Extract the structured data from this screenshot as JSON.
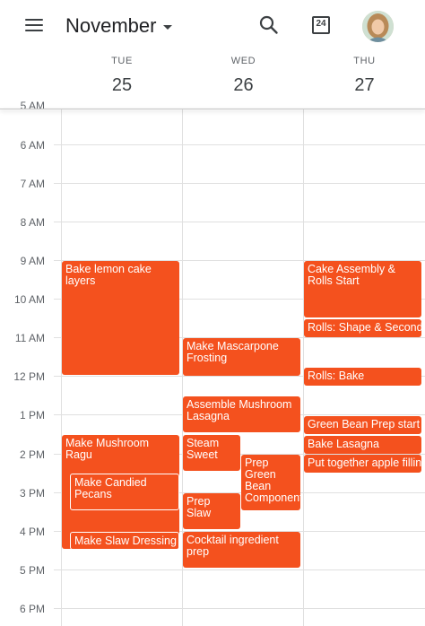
{
  "header": {
    "month": "November",
    "today_num": "24"
  },
  "days": [
    {
      "name": "TUE",
      "num": "25"
    },
    {
      "name": "WED",
      "num": "26"
    },
    {
      "name": "THU",
      "num": "27"
    }
  ],
  "time_labels": [
    "5 AM",
    "6 AM",
    "7 AM",
    "8 AM",
    "9 AM",
    "10 AM",
    "11 AM",
    "12 PM",
    "1 PM",
    "2 PM",
    "3 PM",
    "4 PM",
    "5 PM",
    "6 PM"
  ],
  "events": [
    {
      "day": "TUE",
      "title": "Bake lemon cake layers",
      "color": "#f4511e"
    },
    {
      "day": "TUE",
      "title": "Make Mushroom Ragu",
      "color": "#f4511e"
    },
    {
      "day": "TUE",
      "title": "Make Candied Pecans",
      "color": "#f4511e"
    },
    {
      "day": "TUE",
      "title": "Make Slaw Dressing",
      "color": "#f4511e"
    },
    {
      "day": "WED",
      "title": "Make Mascarpone Frosting",
      "color": "#f4511e"
    },
    {
      "day": "WED",
      "title": "Assemble Mushroom Lasagna",
      "color": "#f4511e"
    },
    {
      "day": "WED",
      "title": "Steam Sweet",
      "color": "#f4511e"
    },
    {
      "day": "WED",
      "title": "Prep Green Bean Components",
      "color": "#f4511e"
    },
    {
      "day": "WED",
      "title": "Prep Slaw",
      "color": "#f4511e"
    },
    {
      "day": "WED",
      "title": "Cocktail ingredient prep",
      "color": "#f4511e"
    },
    {
      "day": "THU",
      "title": "Cake Assembly & Rolls Start",
      "color": "#f4511e"
    },
    {
      "day": "THU",
      "title": "Rolls: Shape & Second Rise",
      "color": "#f4511e"
    },
    {
      "day": "THU",
      "title": "Rolls: Bake",
      "color": "#f4511e"
    },
    {
      "day": "THU",
      "title": "Green Bean Prep start",
      "color": "#f4511e"
    },
    {
      "day": "THU",
      "title": "Bake Lasagna",
      "color": "#f4511e"
    },
    {
      "day": "THU",
      "title": "Put together apple filling",
      "color": "#f4511e"
    }
  ]
}
